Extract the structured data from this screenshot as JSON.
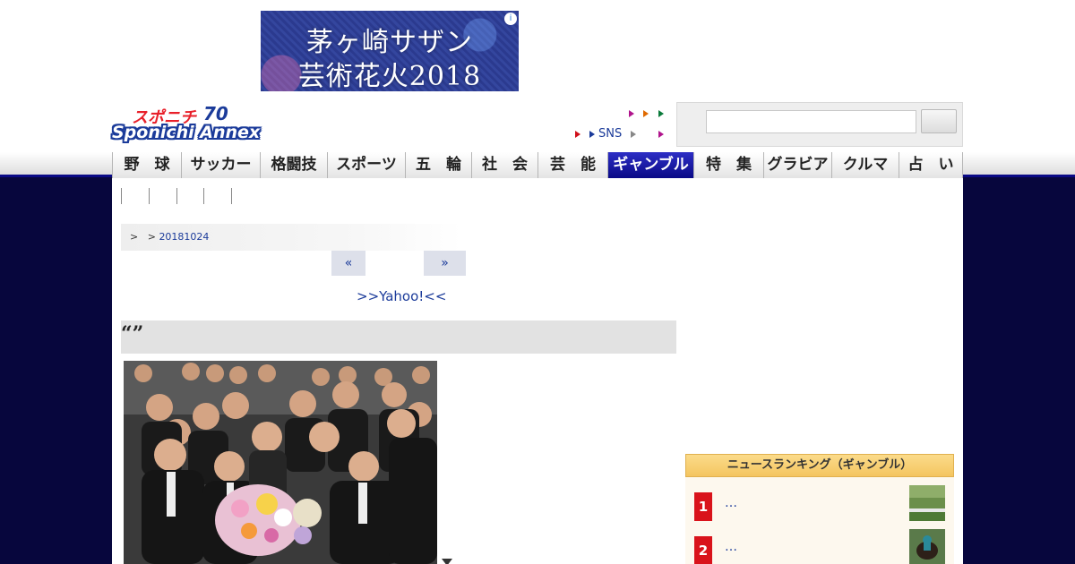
{
  "ad": {
    "line1": "茅ヶ崎サザン",
    "line2": "芸術花火2018",
    "info_icon": "info-icon"
  },
  "logo": {
    "top": "スポニチ",
    "anniversary": "70",
    "bottom": "Sponichi Annex"
  },
  "header_links": {
    "sns": "SNS"
  },
  "search": {
    "value": "",
    "placeholder": ""
  },
  "nav": {
    "items": [
      {
        "label": "野　球",
        "active": false
      },
      {
        "label": "サッカー",
        "active": false
      },
      {
        "label": "格闘技",
        "active": false
      },
      {
        "label": "スポーツ",
        "active": false
      },
      {
        "label": "五　輪",
        "active": false
      },
      {
        "label": "社　会",
        "active": false
      },
      {
        "label": "芸　能",
        "active": false
      },
      {
        "label": "ギャンブル",
        "active": true
      },
      {
        "label": "特　集",
        "active": false
      },
      {
        "label": "グラビア",
        "active": false
      },
      {
        "label": "クルマ",
        "active": false
      },
      {
        "label": "占　い",
        "active": false
      }
    ]
  },
  "breadcrumb": {
    "sep1": ">",
    "sep2": ">",
    "date": "20181024"
  },
  "pager": {
    "prev": "«",
    "next": "»"
  },
  "yahoo_link": ">>Yahoo!<<",
  "headline": "“”",
  "ranking": {
    "title": "ニュースランキング（ギャンブル）",
    "items": [
      {
        "rank": "1",
        "text": "…"
      },
      {
        "rank": "2",
        "text": "…"
      }
    ]
  },
  "colors": {
    "navy": "#07063d",
    "nav_active": "#0a0a86",
    "link": "#1b3b9a",
    "rank_red": "#d9131b",
    "rank_header": "#f4c560"
  }
}
